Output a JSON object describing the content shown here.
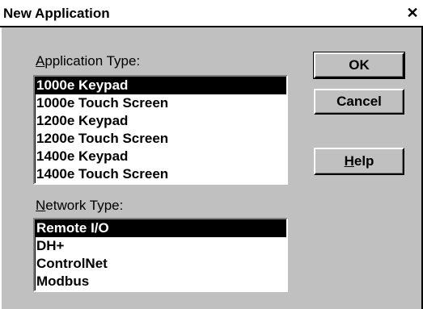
{
  "window": {
    "title": "New Application",
    "close_glyph": "✕"
  },
  "application_type": {
    "label_accel": "A",
    "label_rest": "pplication Type:",
    "items": [
      "1000e Keypad",
      "1000e Touch Screen",
      "1200e Keypad",
      "1200e Touch Screen",
      "1400e Keypad",
      "1400e Touch Screen"
    ],
    "selected_index": 0
  },
  "network_type": {
    "label_accel": "N",
    "label_rest": "etwork Type:",
    "items": [
      "Remote I/O",
      "DH+",
      "ControlNet",
      "Modbus"
    ],
    "selected_index": 0
  },
  "buttons": {
    "ok": "OK",
    "cancel": "Cancel",
    "help_accel": "H",
    "help_rest": "elp"
  }
}
